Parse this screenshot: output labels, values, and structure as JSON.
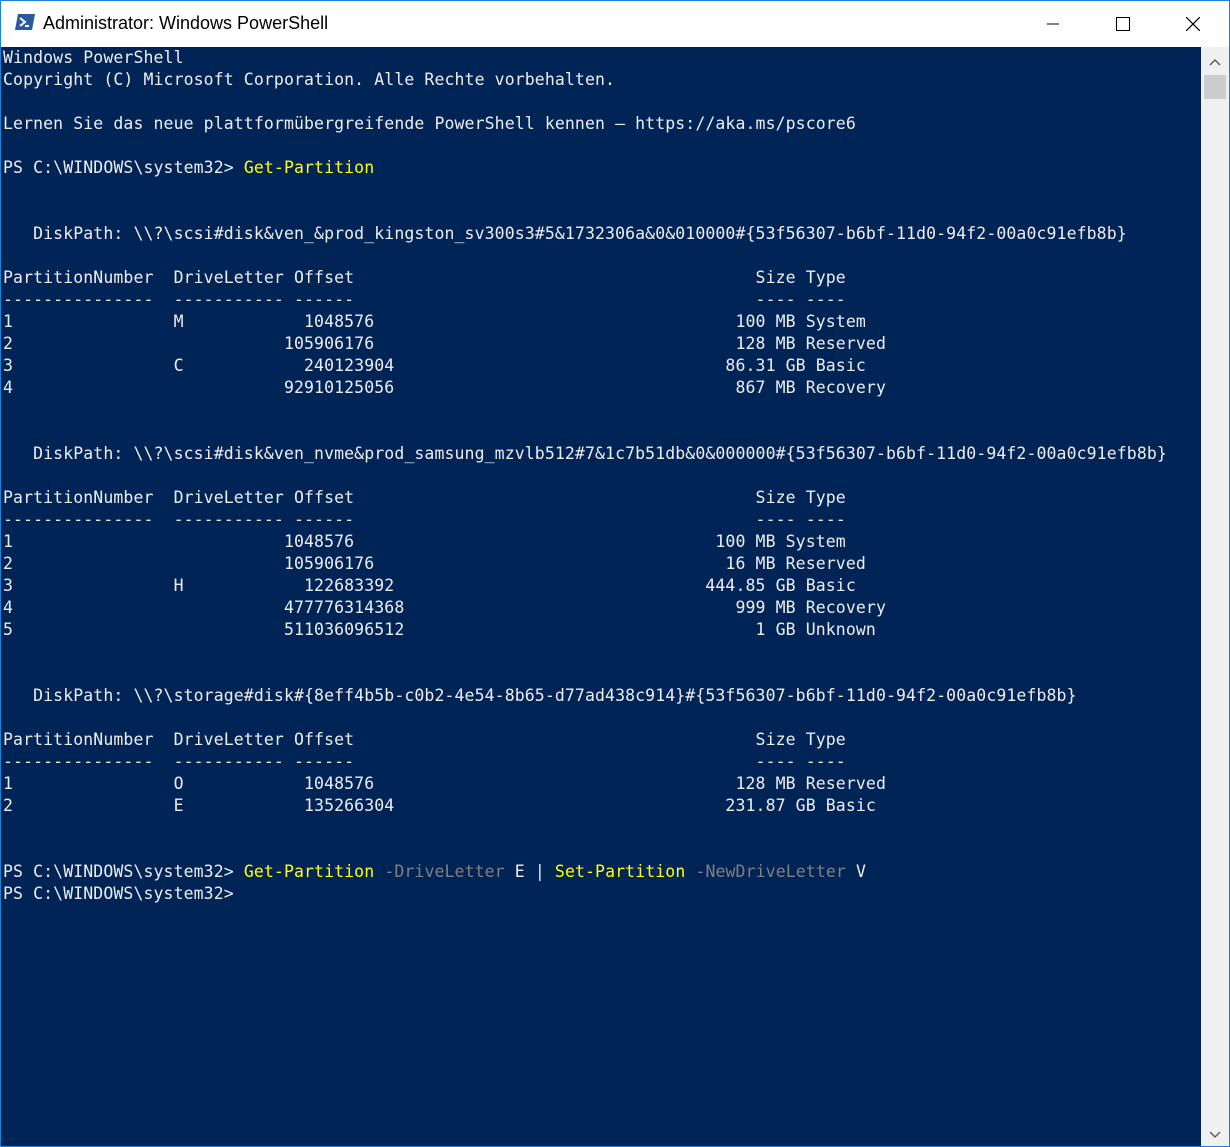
{
  "window": {
    "title": "Administrator: Windows PowerShell",
    "accent": "#1883d7",
    "console_bg": "#012456",
    "console_fg": "#eeedf0",
    "command_color": "#ffff00",
    "parameter_color": "#808080"
  },
  "icons": {
    "app": "powershell-icon",
    "minimize": "minimize-icon",
    "maximize": "maximize-icon",
    "close": "close-icon",
    "scroll_up": "scroll-up-arrow-icon",
    "scroll_down": "scroll-down-arrow-icon"
  },
  "console": {
    "lines": [
      [
        {
          "t": "Windows PowerShell"
        }
      ],
      [
        {
          "t": "Copyright (C) Microsoft Corporation. Alle Rechte vorbehalten."
        }
      ],
      [],
      [
        {
          "t": "Lernen Sie das neue plattformübergreifende PowerShell kennen – https://aka.ms/pscore6"
        }
      ],
      [],
      [
        {
          "t": "PS C:\\WINDOWS\\system32> "
        },
        {
          "t": "Get-Partition",
          "c": "cmd"
        }
      ],
      [],
      [],
      [
        {
          "t": "   DiskPath: \\\\?\\scsi#disk&ven_&prod_kingston_sv300s3#5&1732306a&0&010000#{53f56307-b6bf-11d0-94f2-00a0c91efb8b}"
        }
      ],
      [],
      [
        {
          "t": "PartitionNumber  DriveLetter Offset                                        Size Type"
        }
      ],
      [
        {
          "t": "---------------  ----------- ------                                        ---- ----"
        }
      ],
      [
        {
          "t": "1                M            1048576                                    100 MB System"
        }
      ],
      [
        {
          "t": "2                           105906176                                    128 MB Reserved"
        }
      ],
      [
        {
          "t": "3                C            240123904                                 86.31 GB Basic"
        }
      ],
      [
        {
          "t": "4                           92910125056                                  867 MB Recovery"
        }
      ],
      [],
      [],
      [
        {
          "t": "   DiskPath: \\\\?\\scsi#disk&ven_nvme&prod_samsung_mzvlb512#7&1c7b51db&0&000000#{53f56307-b6bf-11d0-94f2-00a0c91efb8b}"
        }
      ],
      [],
      [
        {
          "t": "PartitionNumber  DriveLetter Offset                                        Size Type"
        }
      ],
      [
        {
          "t": "---------------  ----------- ------                                        ---- ----"
        }
      ],
      [
        {
          "t": "1                           1048576                                    100 MB System"
        }
      ],
      [
        {
          "t": "2                           105906176                                   16 MB Reserved"
        }
      ],
      [
        {
          "t": "3                H            122683392                               444.85 GB Basic"
        }
      ],
      [
        {
          "t": "4                           477776314368                                 999 MB Recovery"
        }
      ],
      [
        {
          "t": "5                           511036096512                                   1 GB Unknown"
        }
      ],
      [],
      [],
      [
        {
          "t": "   DiskPath: \\\\?\\storage#disk#{8eff4b5b-c0b2-4e54-8b65-d77ad438c914}#{53f56307-b6bf-11d0-94f2-00a0c91efb8b}"
        }
      ],
      [],
      [
        {
          "t": "PartitionNumber  DriveLetter Offset                                        Size Type"
        }
      ],
      [
        {
          "t": "---------------  ----------- ------                                        ---- ----"
        }
      ],
      [
        {
          "t": "1                O            1048576                                    128 MB Reserved"
        }
      ],
      [
        {
          "t": "2                E            135266304                                 231.87 GB Basic"
        }
      ],
      [],
      [],
      [
        {
          "t": "PS C:\\WINDOWS\\system32> "
        },
        {
          "t": "Get-Partition",
          "c": "cmd"
        },
        {
          "t": " "
        },
        {
          "t": "-DriveLetter",
          "c": "param"
        },
        {
          "t": " E "
        },
        {
          "t": "|",
          "c": "op"
        },
        {
          "t": " "
        },
        {
          "t": "Set-Partition",
          "c": "cmd"
        },
        {
          "t": " "
        },
        {
          "t": "-NewDriveLetter",
          "c": "param"
        },
        {
          "t": " V"
        }
      ],
      [
        {
          "t": "PS C:\\WINDOWS\\system32>"
        }
      ]
    ]
  }
}
